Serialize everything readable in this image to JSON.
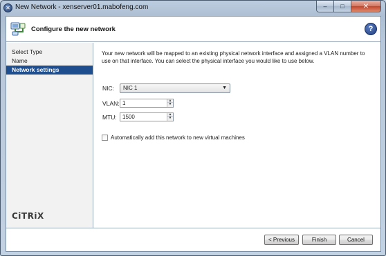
{
  "window": {
    "title": "New Network - xenserver01.mabofeng.com",
    "controls": {
      "minimize": "–",
      "maximize": "□",
      "close": "✕"
    }
  },
  "header": {
    "title": "Configure the new network",
    "help_label": "?"
  },
  "sidebar": {
    "items": [
      {
        "label": "Select Type",
        "active": false
      },
      {
        "label": "Name",
        "active": false
      },
      {
        "label": "Network settings",
        "active": true
      }
    ],
    "logo_text": "CiTRiX"
  },
  "main": {
    "intro": "Your new network will be mapped to an existing physical network interface and assigned a VLAN number to use on that interface. You can select the physical interface you would like to use below.",
    "nic": {
      "label": "NIC:",
      "value": "NIC 1"
    },
    "vlan": {
      "label": "VLAN:",
      "value": "1"
    },
    "mtu": {
      "label": "MTU:",
      "value": "1500"
    },
    "auto_add": {
      "label": "Automatically add this network to new virtual machines",
      "checked": false
    }
  },
  "footer": {
    "previous_label": "< Previous",
    "finish_label": "Finish",
    "cancel_label": "Cancel"
  },
  "colors": {
    "accent": "#1f4e8f",
    "frame": "#b8c8da"
  }
}
